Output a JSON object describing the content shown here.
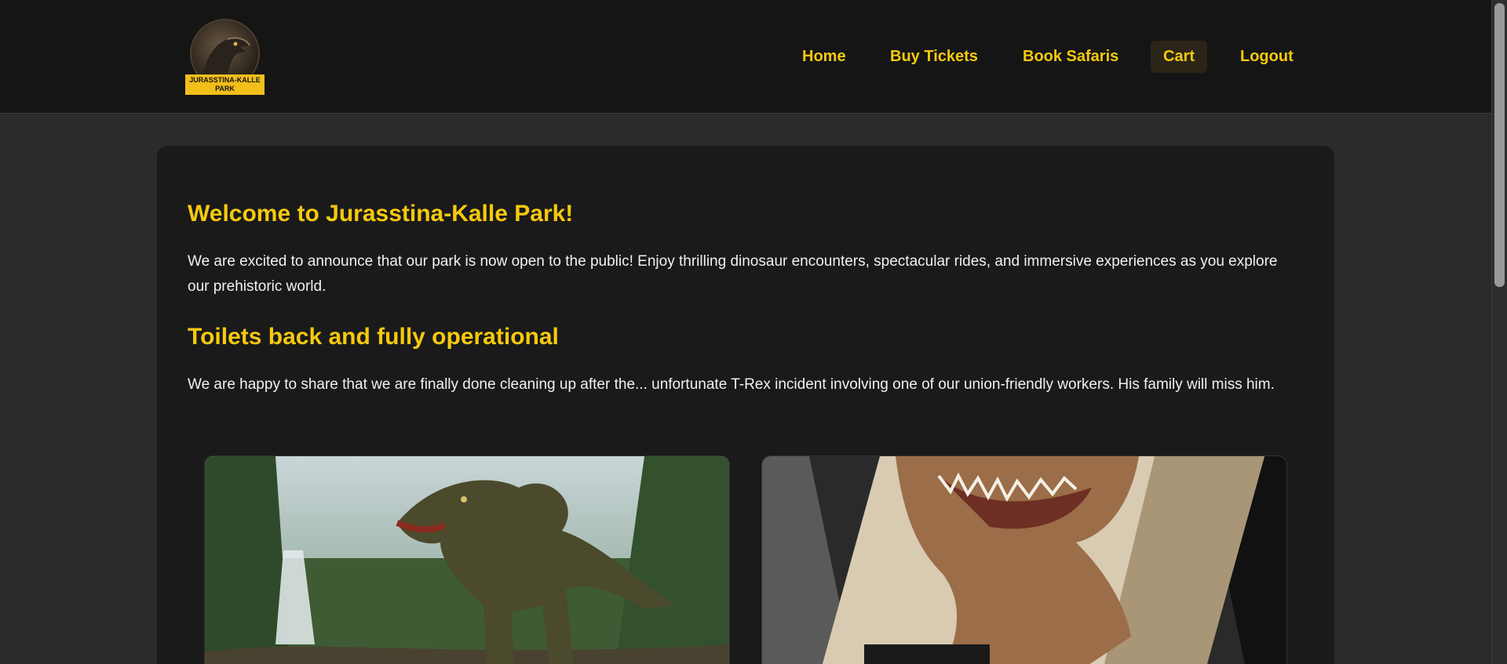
{
  "logo": {
    "line1": "JURASSTINA-KALLE",
    "line2": "PARK"
  },
  "nav": {
    "items": [
      {
        "label": "Home"
      },
      {
        "label": "Buy Tickets"
      },
      {
        "label": "Book Safaris"
      },
      {
        "label": "Cart",
        "active": true
      },
      {
        "label": "Logout"
      }
    ]
  },
  "main": {
    "welcome_title": "Welcome to Jurasstina-Kalle Park!",
    "welcome_text": "We are excited to announce that our park is now open to the public! Enjoy thrilling dinosaur encounters, spectacular rides, and immersive experiences as you explore our prehistoric world.",
    "toilets_title": "Toilets back and fully operational",
    "toilets_text": "We are happy to share that we are finally done cleaning up after the... unfortunate T-Rex incident involving one of our union-friendly workers. His family will miss him."
  },
  "colors": {
    "accent": "#f6c90e",
    "header_bg": "#151515",
    "page_bg": "#2b2b2b",
    "card_bg": "#1a1a1a"
  }
}
